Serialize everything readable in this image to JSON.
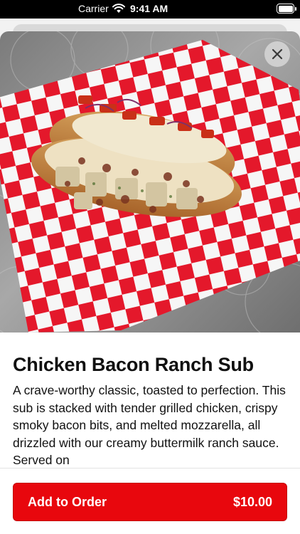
{
  "status_bar": {
    "carrier": "Carrier",
    "time": "9:41 AM",
    "icons": [
      "wifi-icon",
      "battery-icon"
    ]
  },
  "hero_image": {
    "subject": "chicken-bacon-ranch-sub-photo",
    "colors": {
      "checker_red": "#e4182b",
      "checker_white": "#f6f6f6",
      "background_metal": "#8f8f8f"
    }
  },
  "close_icon": "close-icon",
  "item": {
    "title": "Chicken Bacon Ranch Sub",
    "description": "A crave-worthy classic, toasted to perfection. This sub is stacked with tender grilled chicken, crispy smoky bacon bits, and melted mozzarella, all drizzled with our creamy buttermilk ranch sauce. Served on"
  },
  "cta": {
    "label": "Add to Order",
    "price": "$10.00",
    "color": "#e8070d"
  }
}
